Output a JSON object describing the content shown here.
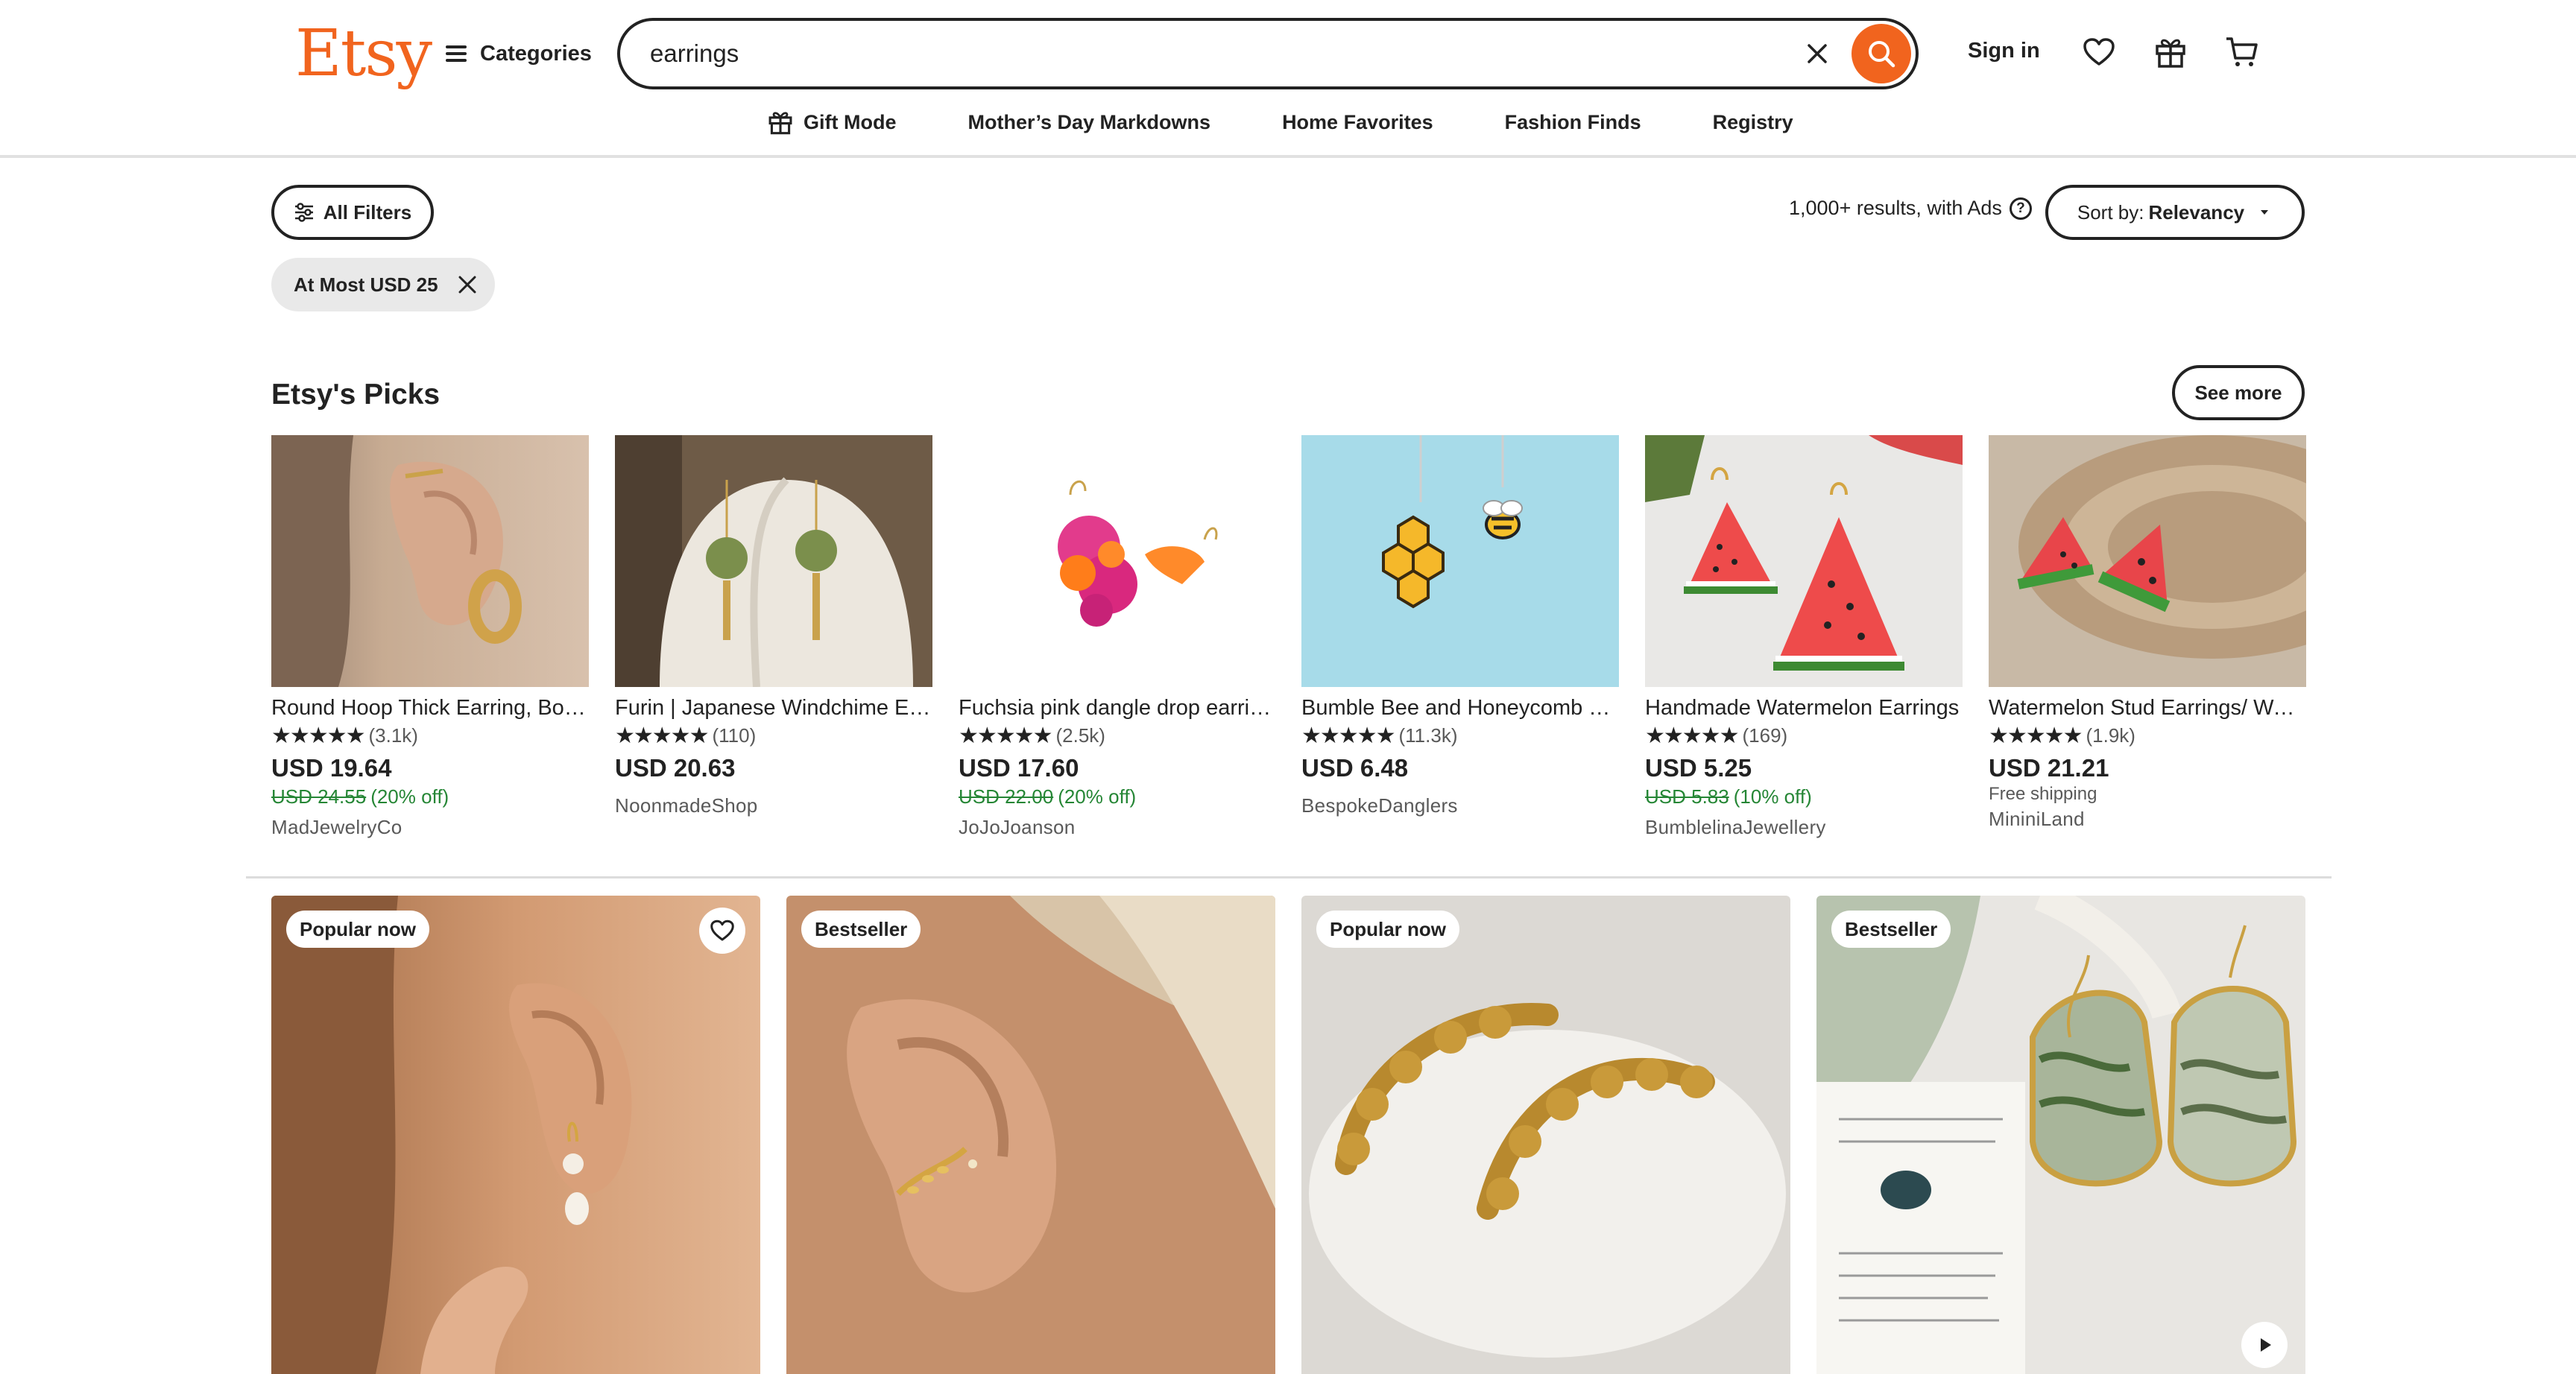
{
  "header": {
    "logo": "Etsy",
    "categories_label": "Categories",
    "search_value": "earrings",
    "signin_label": "Sign in",
    "accent_color": "#f1641e"
  },
  "subnav": [
    {
      "label": "Gift Mode",
      "icon": "gift-icon"
    },
    {
      "label": "Mother’s Day Markdowns"
    },
    {
      "label": "Home Favorites"
    },
    {
      "label": "Fashion Finds"
    },
    {
      "label": "Registry"
    }
  ],
  "filters": {
    "all_filters_label": "All Filters",
    "results_text": "1,000+ results, with Ads",
    "sort_prefix": "Sort by:",
    "sort_value": "Relevancy",
    "active_chip": "At Most USD 25"
  },
  "picks": {
    "title": "Etsy's Picks",
    "see_more_label": "See more",
    "items": [
      {
        "title": "Round Hoop Thick Earring, Bold Gold Hoops",
        "stars": "★★★★★",
        "reviews": "(3.1k)",
        "price": "USD 19.64",
        "original": "USD 24.55",
        "discount": "(20% off)",
        "shop": "MadJewelryCo"
      },
      {
        "title": "Furin | Japanese Windchime Earrings",
        "stars": "★★★★★",
        "reviews": "(110)",
        "price": "USD 20.63",
        "shop": "NoonmadeShop"
      },
      {
        "title": "Fuchsia pink dangle drop earrings",
        "stars": "★★★★★",
        "reviews": "(2.5k)",
        "price": "USD 17.60",
        "original": "USD 22.00",
        "discount": "(20% off)",
        "shop": "JoJoJoanson"
      },
      {
        "title": "Bumble Bee and Honeycomb Earrings",
        "stars": "★★★★★",
        "reviews": "(11.3k)",
        "price": "USD 6.48",
        "shop": "BespokeDanglers"
      },
      {
        "title": "Handmade Watermelon Earrings",
        "stars": "★★★★★",
        "reviews": "(169)",
        "price": "USD 5.25",
        "original": "USD 5.83",
        "discount": "(10% off)",
        "shop": "BumblelinaJewellery"
      },
      {
        "title": "Watermelon Stud Earrings/ Watermelon Jewelry",
        "stars": "★★★★★",
        "reviews": "(1.9k)",
        "price": "USD 21.21",
        "shipping": "Free shipping",
        "shop": "MininiLand"
      }
    ]
  },
  "listings": [
    {
      "badge": "Popular now"
    },
    {
      "badge": "Bestseller"
    },
    {
      "badge": "Popular now"
    },
    {
      "badge": "Bestseller"
    }
  ]
}
